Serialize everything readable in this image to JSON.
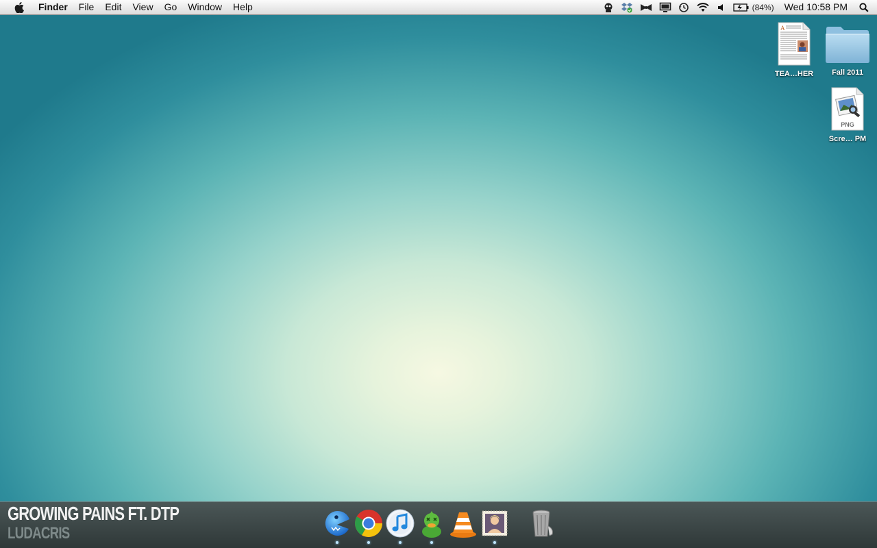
{
  "menubar": {
    "app_name": "Finder",
    "menus": [
      "File",
      "Edit",
      "View",
      "Go",
      "Window",
      "Help"
    ],
    "status_icons": [
      "scanner-icon",
      "dropbox-icon",
      "bowtie-icon",
      "display-mirroring-icon",
      "time-machine-icon",
      "wifi-icon",
      "volume-icon",
      "battery-icon"
    ],
    "battery_percent": "(84%)",
    "clock": "Wed 10:58 PM"
  },
  "desktop": {
    "icons": [
      {
        "label": "TEA…HER",
        "kind": "document"
      },
      {
        "label": "Fall 2011",
        "kind": "folder"
      },
      {
        "label": "Scre… PM",
        "kind": "png",
        "badge": "PNG"
      }
    ]
  },
  "now_playing": {
    "title": "GROWING PAINS FT. DTP",
    "artist": "LUDACRIS"
  },
  "dock": {
    "items": [
      {
        "name": "pacifist-app-icon",
        "running": true
      },
      {
        "name": "chrome-icon",
        "running": true
      },
      {
        "name": "itunes-icon",
        "running": true
      },
      {
        "name": "adium-icon",
        "running": true
      },
      {
        "name": "vlc-icon",
        "running": false
      },
      {
        "name": "mail-stamp-icon",
        "running": true
      },
      {
        "name": "trash-icon",
        "running": false
      }
    ]
  },
  "colors": {
    "desktop_center": "#f6f8e2",
    "desktop_edge": "#1f7a8c",
    "dock_bar": "#3a4545",
    "menubar": "#f0f0f0"
  }
}
